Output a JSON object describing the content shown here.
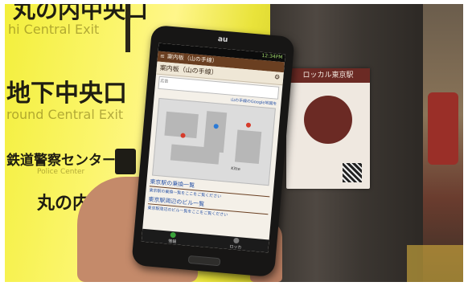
{
  "sign": {
    "line1_jp": "丸の内中央口",
    "line1_en": "hi Central Exit",
    "line2_jp": "地下中央口",
    "line2_en": "round Central Exit",
    "line3_jp": "鉄道警察センター",
    "line3_en": "Police Center",
    "line4_jp": "丸の内北口"
  },
  "poster": {
    "header": "ロッカル東京駅"
  },
  "phone": {
    "brand": "au",
    "status_time": "12:34PM",
    "appbar_title": "案内板（山の手線）",
    "page_title": "案内板（山の手線）",
    "ad_text": "広告",
    "map_link": "山の手線のGoogle地図を",
    "map_label": "Kitte",
    "list_items": [
      {
        "title": "東京駅の乗換一覧",
        "sub": "東京駅の乗換一覧をここをご覧ください"
      },
      {
        "title": "東京駅周辺のビル一覧",
        "sub": "東京駅周辺のビル一覧をここをご覧ください"
      }
    ],
    "nav": [
      {
        "label": "情報"
      },
      {
        "label": "ロッカ"
      }
    ]
  }
}
